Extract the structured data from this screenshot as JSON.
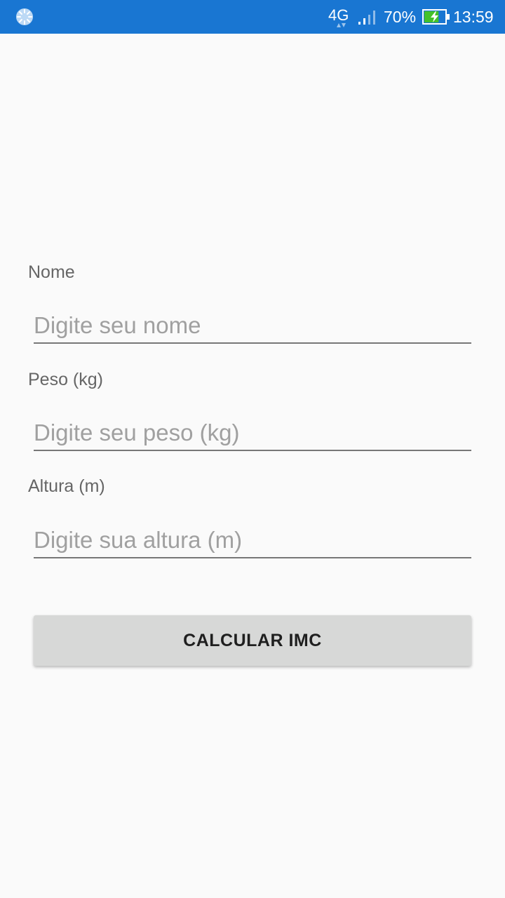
{
  "status_bar": {
    "network_type": "4G",
    "battery_percent": "70%",
    "battery_level": 0.7,
    "battery_charging": true,
    "time": "13:59",
    "background_color": "#1976d2",
    "left_icon": "loading-spinner-icon"
  },
  "form": {
    "fields": [
      {
        "label": "Nome",
        "placeholder": "Digite seu nome"
      },
      {
        "label": "Peso (kg)",
        "placeholder": "Digite seu peso (kg)"
      },
      {
        "label": "Altura (m)",
        "placeholder": "Digite sua altura (m)"
      }
    ],
    "submit_label": "CALCULAR IMC"
  }
}
